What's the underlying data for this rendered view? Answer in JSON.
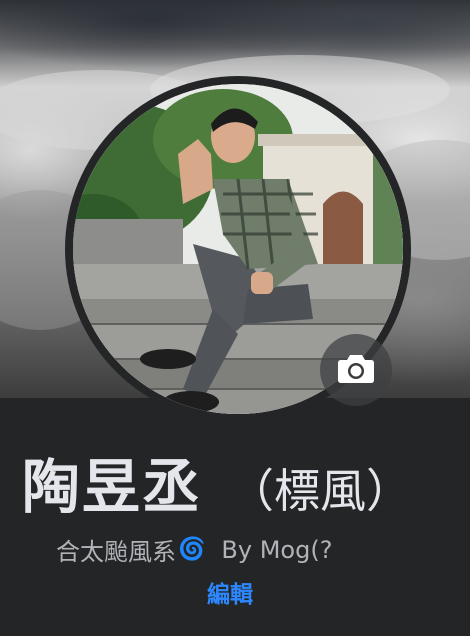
{
  "profile": {
    "name": "陶昱丞",
    "alternate_name": "（標風）",
    "bio_text": "合太颱風系",
    "bio_emoji": "🌀",
    "bio_suffix": "By Mog(?",
    "edit_label": "編輯"
  },
  "icons": {
    "camera": "camera-icon"
  },
  "colors": {
    "background": "#242526",
    "name": "#e4e6eb",
    "bio": "#b0b3b8",
    "link": "#2d88ff"
  }
}
